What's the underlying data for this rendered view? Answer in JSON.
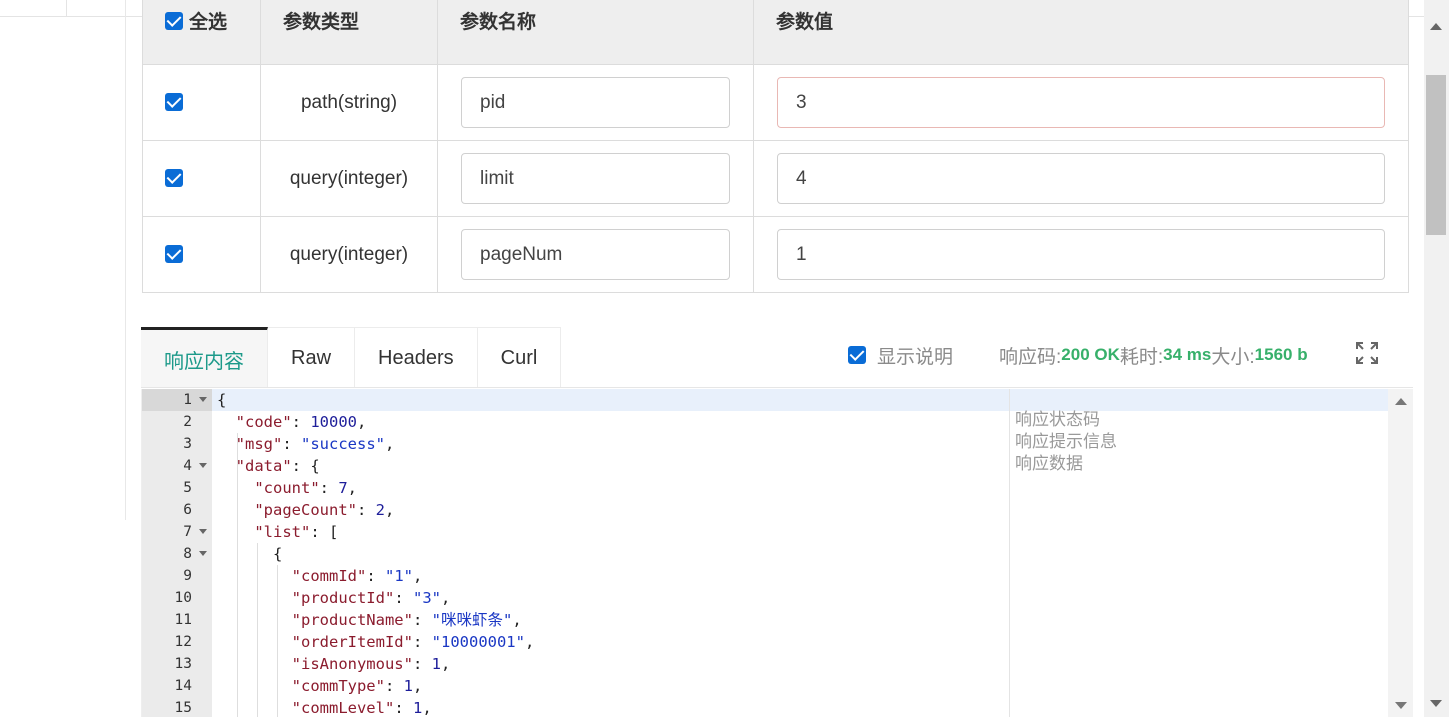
{
  "params_table": {
    "headers": [
      "全选",
      "参数类型",
      "参数名称",
      "参数值"
    ],
    "rows": [
      {
        "checked": true,
        "type": "path(string)",
        "name": "pid",
        "value": "3"
      },
      {
        "checked": true,
        "type": "query(integer)",
        "name": "limit",
        "value": "4"
      },
      {
        "checked": true,
        "type": "query(integer)",
        "name": "pageNum",
        "value": "1"
      }
    ]
  },
  "tabs": [
    {
      "label": "响应内容",
      "active": true
    },
    {
      "label": "Raw",
      "active": false
    },
    {
      "label": "Headers",
      "active": false
    },
    {
      "label": "Curl",
      "active": false
    }
  ],
  "response_meta": {
    "show_desc_label": "显示说明",
    "status_label": "响应码:",
    "status_value": "200 OK",
    "time_label": "耗时:",
    "time_value": "34 ms",
    "size_label": "大小:",
    "size_value": "1560 b"
  },
  "editor": {
    "line_numbers": [
      "1",
      "2",
      "3",
      "4",
      "5",
      "6",
      "7",
      "8",
      "9",
      "10",
      "11",
      "12",
      "13",
      "14",
      "15"
    ],
    "descriptions": [
      "响应状态码",
      "响应提示信息",
      "响应数据"
    ]
  },
  "colors": {
    "accent_tab": "#1d9a8a",
    "meta_green": "#37b06a",
    "checkbox": "#0a6cd6"
  }
}
